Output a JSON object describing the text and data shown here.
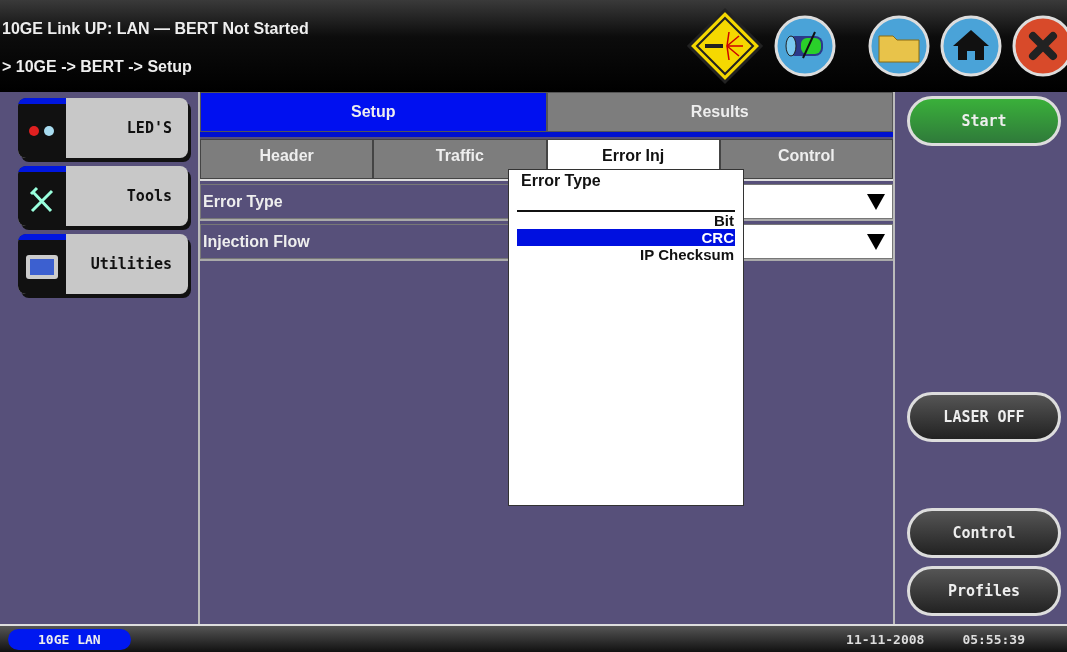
{
  "header": {
    "status": "10GE Link UP: LAN  — BERT Not Started",
    "breadcrumb": "> 10GE -> BERT -> Setup"
  },
  "sidebar": [
    {
      "label": "LED'S",
      "kind": "leds"
    },
    {
      "label": "Tools",
      "kind": "tools"
    },
    {
      "label": "Utilities",
      "kind": "utilities"
    }
  ],
  "tabs": [
    {
      "label": "Setup",
      "selected": true
    },
    {
      "label": "Results",
      "selected": false
    }
  ],
  "subtabs": [
    {
      "label": "Header",
      "selected": false
    },
    {
      "label": "Traffic",
      "selected": false
    },
    {
      "label": "Error Inj",
      "selected": true
    },
    {
      "label": "Control",
      "selected": false
    }
  ],
  "fields": [
    {
      "label": "Error Type"
    },
    {
      "label": "Injection Flow"
    }
  ],
  "dropdown": {
    "title": "Error Type",
    "options": [
      {
        "label": "Bit",
        "selected": false
      },
      {
        "label": "CRC",
        "selected": true
      },
      {
        "label": "IP Checksum",
        "selected": false
      }
    ]
  },
  "right_buttons": [
    {
      "label": "Start",
      "kind": "start"
    },
    {
      "label": "LASER OFF",
      "kind": "normal"
    },
    {
      "label": "Control",
      "kind": "normal"
    },
    {
      "label": "Profiles",
      "kind": "normal"
    }
  ],
  "status_bar": {
    "mode": "10GE LAN",
    "date": "11-11-2008",
    "time": "05:55:39"
  }
}
